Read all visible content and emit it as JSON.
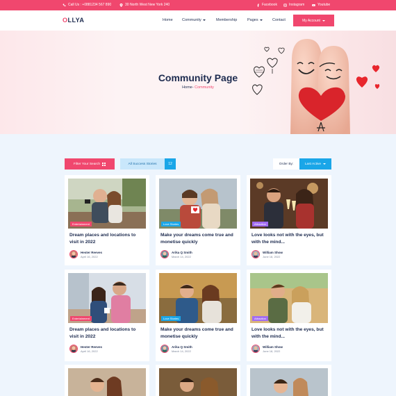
{
  "topbar": {
    "phone": "Call Us : +0881234 567 890",
    "address": "30 North West New York 240",
    "social": [
      "Facebook",
      "Instagram",
      "Youtube"
    ]
  },
  "header": {
    "logo_accent": "O",
    "logo_rest": "LLYA",
    "nav": [
      "Home",
      "Community",
      "Membership",
      "Pages",
      "Contact"
    ],
    "account_label": "My Account"
  },
  "hero": {
    "title": "Community Page",
    "crumb_home": "Home",
    "crumb_sep": "- ",
    "crumb_current": "Community"
  },
  "filters": {
    "filter_label": "Filter Your Search",
    "stories_label": "All Success Stories",
    "stories_count": "12",
    "order_label": "Order By:",
    "order_value": "Last Active"
  },
  "cards": [
    {
      "tag": "Entertainment",
      "tag_color": "#f0476e",
      "title": "Dream places and locations to visit in 2022",
      "author": "Hester Reeves",
      "date": "April 16, 2022"
    },
    {
      "tag": "Love Stories",
      "tag_color": "#1aa6e8",
      "title": "Make your dreams come true and monetise quickly",
      "author": "Arika Q Smith",
      "date": "March 14, 2022"
    },
    {
      "tag": "Attraction",
      "tag_color": "#a26cf2",
      "title": "Love looks not with the eyes, but with the mind...",
      "author": "William Show",
      "date": "June 18, 2022"
    },
    {
      "tag": "Entertainment",
      "tag_color": "#f0476e",
      "title": "Dream places and locations to visit in 2022",
      "author": "Hester Reeves",
      "date": "April 16, 2022"
    },
    {
      "tag": "Love Stories",
      "tag_color": "#1aa6e8",
      "title": "Make your dreams come true and monetise quickly",
      "author": "Arika Q Smith",
      "date": "March 14, 2022"
    },
    {
      "tag": "Attraction",
      "tag_color": "#a26cf2",
      "title": "Love looks not with the eyes, but with the mind...",
      "author": "William Show",
      "date": "June 18, 2022"
    }
  ],
  "colors": {
    "brand": "#f0476e",
    "accent_blue": "#1aa6e8",
    "navy": "#1d2b4f",
    "page_bg": "#eef5fd"
  }
}
